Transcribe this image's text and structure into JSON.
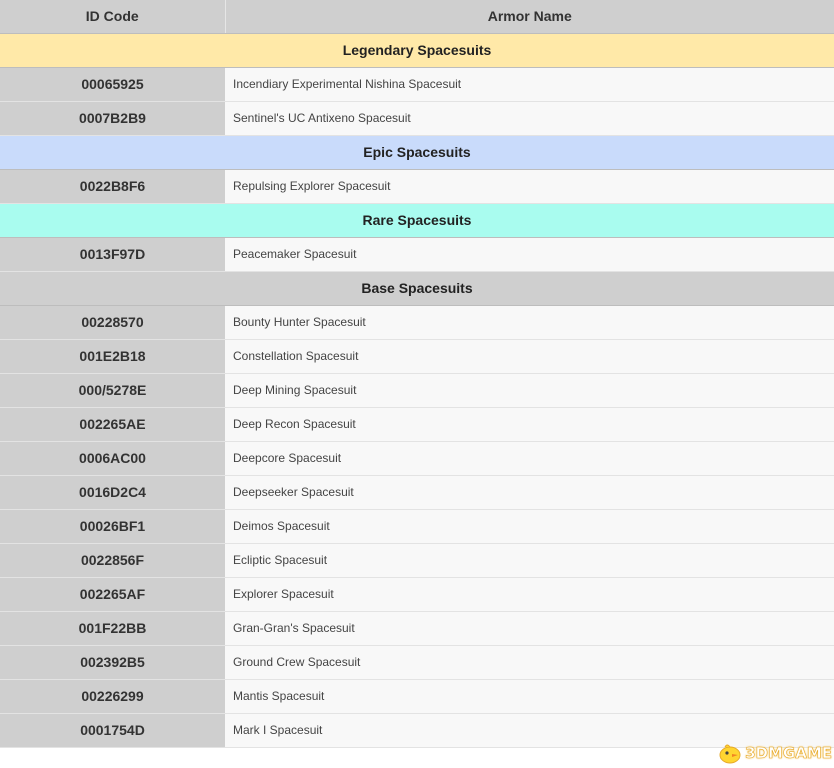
{
  "table": {
    "headers": {
      "id": "ID Code",
      "name": "Armor Name"
    },
    "sections": [
      {
        "title": "Legendary Spacesuits",
        "color": "#ffe9a8",
        "rows": [
          {
            "id": "00065925",
            "name": "Incendiary Experimental Nishina Spacesuit"
          },
          {
            "id": "0007B2B9",
            "name": "Sentinel's UC Antixeno Spacesuit"
          }
        ]
      },
      {
        "title": "Epic Spacesuits",
        "color": "#c9dbfb",
        "rows": [
          {
            "id": "0022B8F6",
            "name": "Repulsing Explorer Spacesuit"
          }
        ]
      },
      {
        "title": "Rare Spacesuits",
        "color": "#a9fcef",
        "rows": [
          {
            "id": "0013F97D",
            "name": "Peacemaker Spacesuit"
          }
        ]
      },
      {
        "title": "Base Spacesuits",
        "color": "#cfcfcf",
        "rows": [
          {
            "id": "00228570",
            "name": "Bounty Hunter Spacesuit"
          },
          {
            "id": "001E2B18",
            "name": "Constellation Spacesuit"
          },
          {
            "id": "000/5278E",
            "name": "Deep Mining Spacesuit"
          },
          {
            "id": "002265AE",
            "name": "Deep Recon Spacesuit"
          },
          {
            "id": "0006AC00",
            "name": "Deepcore Spacesuit"
          },
          {
            "id": "0016D2C4",
            "name": "Deepseeker Spacesuit"
          },
          {
            "id": "00026BF1",
            "name": "Deimos Spacesuit"
          },
          {
            "id": "0022856F",
            "name": "Ecliptic Spacesuit"
          },
          {
            "id": "002265AF",
            "name": "Explorer Spacesuit"
          },
          {
            "id": "001F22BB",
            "name": "Gran-Gran's Spacesuit"
          },
          {
            "id": "002392B5",
            "name": "Ground Crew Spacesuit"
          },
          {
            "id": "00226299",
            "name": "Mantis Spacesuit"
          },
          {
            "id": "0001754D",
            "name": "Mark I Spacesuit"
          }
        ]
      }
    ]
  },
  "watermark": {
    "text": "3DMGAME",
    "icon": "chick-mascot-icon",
    "color": "#e6a318"
  }
}
